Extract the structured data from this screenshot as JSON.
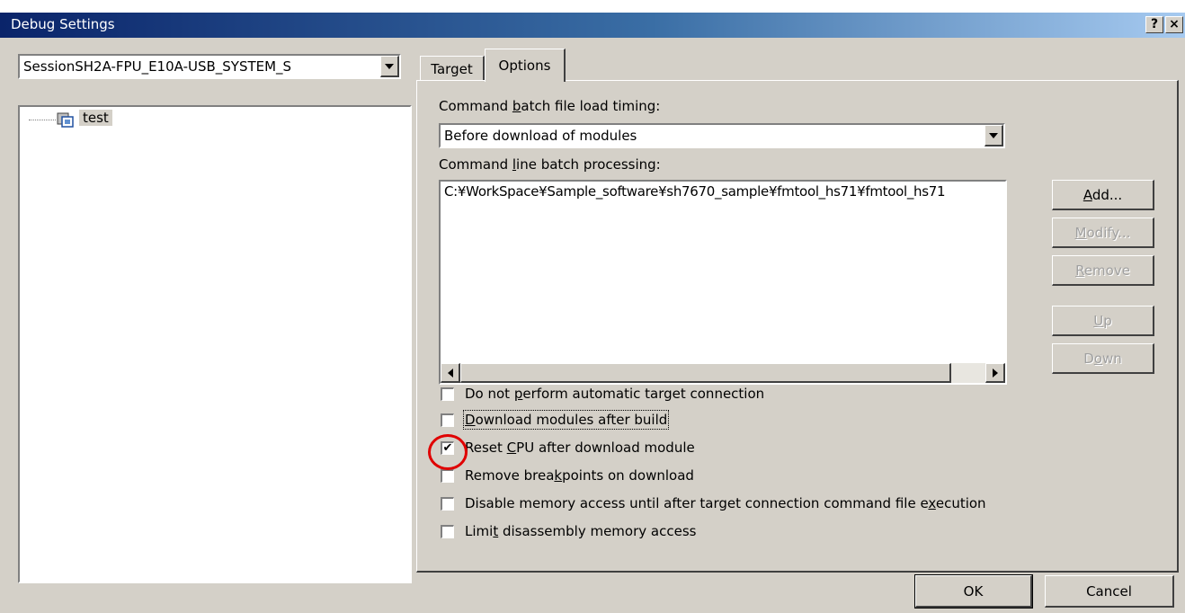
{
  "window": {
    "title": "Debug Settings",
    "help_btn": "?",
    "close_btn": "×"
  },
  "session": {
    "selected": "SessionSH2A-FPU_E10A-USB_SYSTEM_S"
  },
  "tree": {
    "items": [
      {
        "label": "test"
      }
    ]
  },
  "tabs": [
    {
      "label": "Target"
    },
    {
      "label": "Options"
    }
  ],
  "options": {
    "batch_timing_label": {
      "pre": "Command ",
      "u": "b",
      "post": "atch file load timing:"
    },
    "batch_timing_value": "Before download of modules",
    "cmdline_label": {
      "pre": "Command ",
      "u": "l",
      "post": "ine batch processing:"
    },
    "cmdline_items": [
      "C:¥WorkSpace¥Sample_software¥sh7670_sample¥fmtool_hs71¥fmtool_hs71"
    ],
    "buttons": {
      "add": {
        "u": "A",
        "post": "dd..."
      },
      "modify": {
        "u": "M",
        "post": "odify..."
      },
      "remove": {
        "u": "R",
        "post": "emove"
      },
      "up": {
        "u": "U",
        "post": "p"
      },
      "down": {
        "pre": "D",
        "u": "o",
        "post": "wn"
      }
    },
    "checkboxes": [
      {
        "pre": "Do not ",
        "u": "p",
        "post": "erform automatic target connection",
        "checked": false
      },
      {
        "pre": "",
        "u": "D",
        "post": "ownload modules after build",
        "checked": false
      },
      {
        "pre": "Reset ",
        "u": "C",
        "post": "PU after download module",
        "checked": true
      },
      {
        "pre": "Remove brea",
        "u": "k",
        "post": "points on download",
        "checked": false
      },
      {
        "pre": "Disable memory access until after target connection command file e",
        "u": "x",
        "post": "ecution",
        "checked": false
      },
      {
        "pre": "Limi",
        "u": "t",
        "post": " disassembly memory access",
        "checked": false
      }
    ]
  },
  "footer": {
    "ok": "OK",
    "cancel": "Cancel"
  },
  "annotation": {
    "color": "#e00000"
  }
}
